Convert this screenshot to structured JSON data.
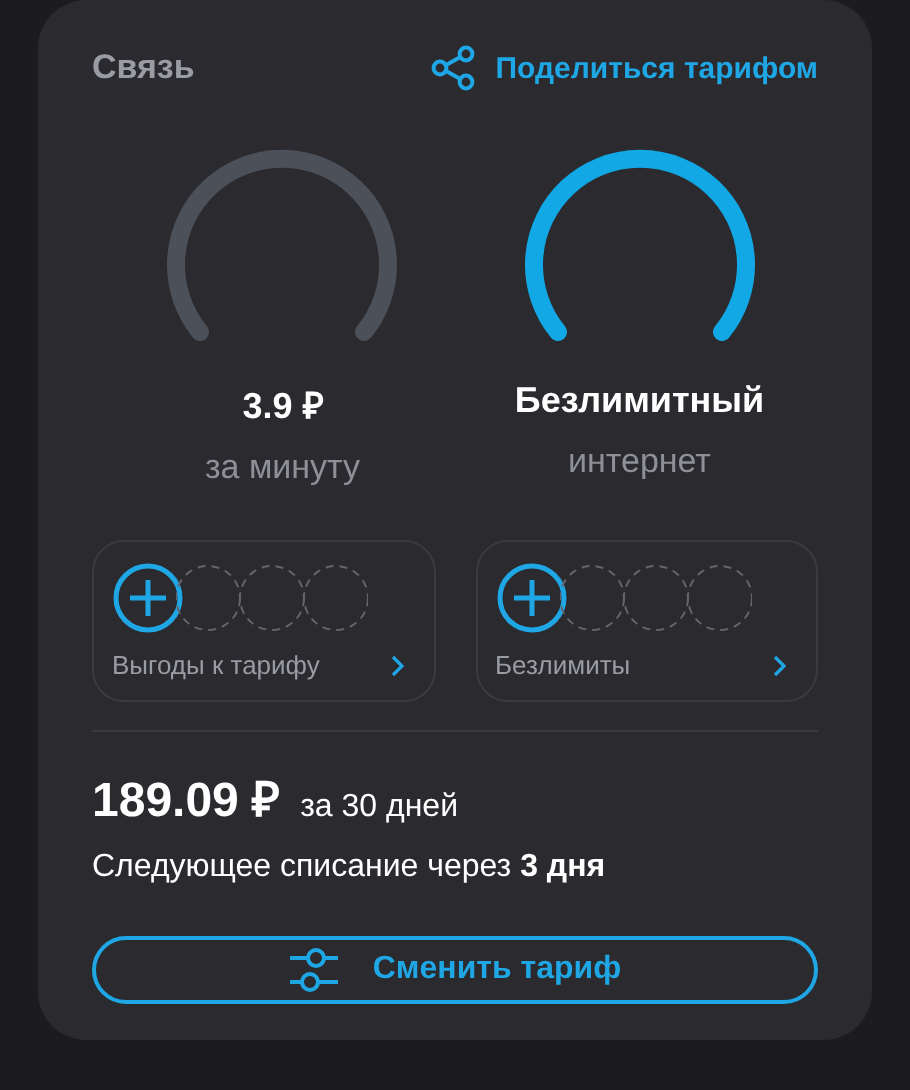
{
  "section": {
    "title": "Связь",
    "share_link": "Поделиться тарифом"
  },
  "gauges": [
    {
      "value": "3.9 ₽",
      "caption": "за минуту",
      "active": false
    },
    {
      "value": "Безлимитный",
      "caption": "интернет",
      "active": true
    }
  ],
  "addons": [
    {
      "label": "Выгоды к тарифу"
    },
    {
      "label": "Безлимиты"
    }
  ],
  "price": {
    "amount": "189.09 ₽",
    "period": "за 30 дней",
    "next_charge": "Следующее списание через **3 дня**"
  },
  "button": "Сменить тариф"
}
